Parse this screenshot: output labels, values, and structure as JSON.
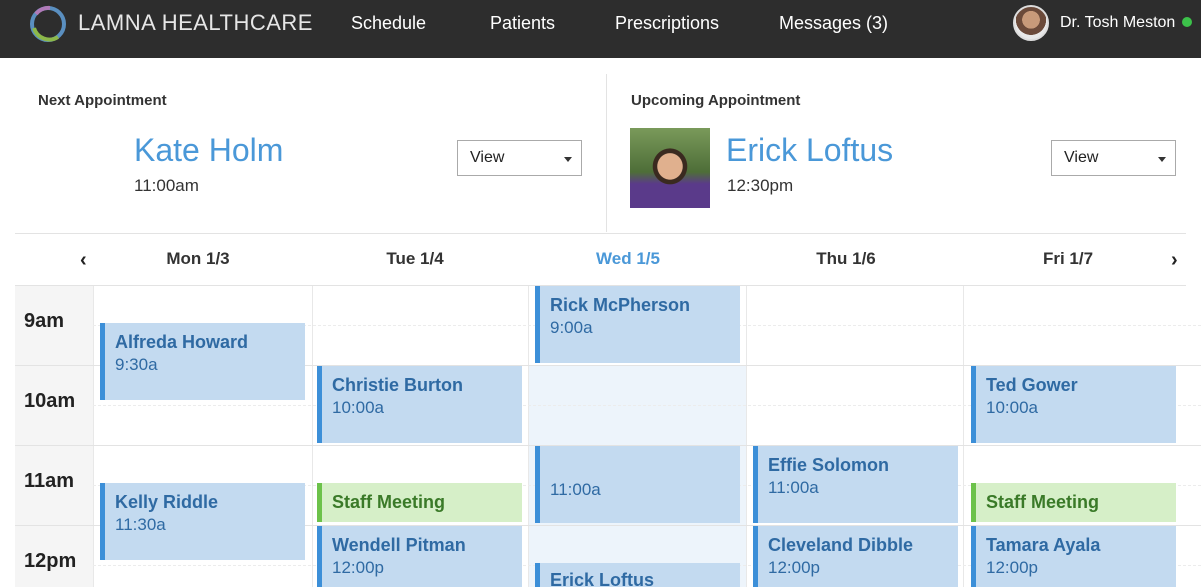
{
  "header": {
    "brand": "LAMNA HEALTHCARE",
    "nav": [
      "Schedule",
      "Patients",
      "Prescriptions",
      "Messages (3)"
    ],
    "user_name": "Dr. Tosh Meston",
    "user_status_color": "#3cc24a"
  },
  "next_appointment": {
    "label": "Next Appointment",
    "name": "Kate Holm",
    "time": "11:00am",
    "action": "View"
  },
  "upcoming_appointment": {
    "label": "Upcoming Appointment",
    "name": "Erick Loftus",
    "time": "12:30pm",
    "action": "View"
  },
  "calendar": {
    "days": [
      "Mon 1/3",
      "Tue 1/4",
      "Wed 1/5",
      "Thu 1/6",
      "Fri 1/7"
    ],
    "today": "Wed 1/5",
    "hours": [
      "9am",
      "10am",
      "11am",
      "12pm"
    ],
    "events": [
      {
        "title": "Alfreda Howard",
        "time": "9:30a",
        "type": "appointment"
      },
      {
        "title": "Kelly Riddle",
        "time": "11:30a",
        "type": "appointment"
      },
      {
        "title": "Christie Burton",
        "time": "10:00a",
        "type": "appointment"
      },
      {
        "title": "Staff Meeting",
        "time": "",
        "type": "meeting"
      },
      {
        "title": "Wendell Pitman",
        "time": "12:00p",
        "type": "appointment"
      },
      {
        "title": "Rick McPherson",
        "time": "9:00a",
        "type": "appointment"
      },
      {
        "title": "",
        "time": "11:00a",
        "type": "appointment"
      },
      {
        "title": "Erick Loftus",
        "time": "",
        "type": "appointment"
      },
      {
        "title": "Effie Solomon",
        "time": "11:00a",
        "type": "appointment"
      },
      {
        "title": "Cleveland Dibble",
        "time": "12:00p",
        "type": "appointment"
      },
      {
        "title": "Ted Gower",
        "time": "10:00a",
        "type": "appointment"
      },
      {
        "title": "Staff Meeting",
        "time": "",
        "type": "meeting"
      },
      {
        "title": "Tamara Ayala",
        "time": "12:00p",
        "type": "appointment"
      }
    ]
  },
  "icons": {
    "logo": "ring-logo-icon",
    "prev": "chevron-left-icon",
    "next": "chevron-right-icon",
    "dropdown": "caret-down-icon"
  },
  "colors": {
    "accent": "#4a98d8",
    "event_bg": "#c3daf0",
    "event_border": "#3c8fd8",
    "meeting_bg": "#d6efc8",
    "meeting_border": "#6cc24a",
    "topbar": "#2d2d2d"
  }
}
